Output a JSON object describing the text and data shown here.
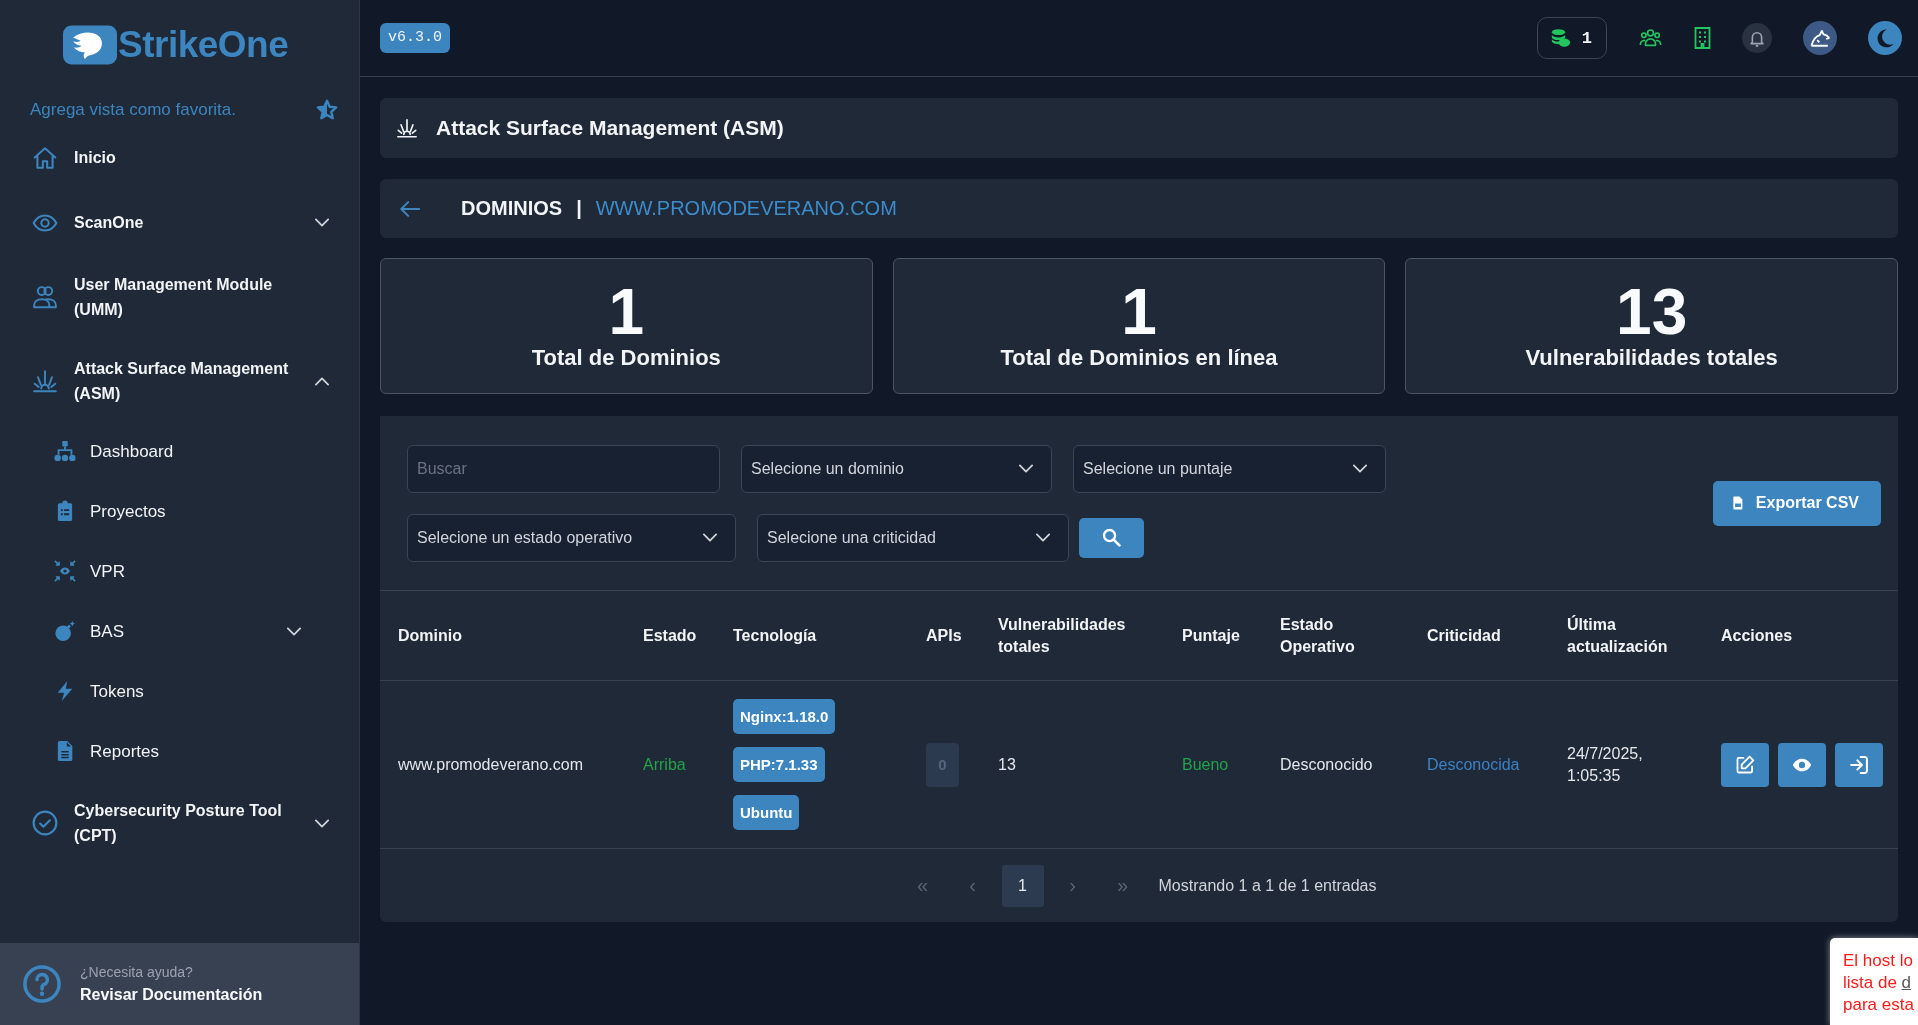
{
  "sidebar": {
    "logo": "StrikeOne",
    "favorite_hint": "Agrega vista como favorita.",
    "nav": [
      {
        "kind": "link",
        "label": "Inicio"
      },
      {
        "kind": "group",
        "label": "ScanOne",
        "expanded": false
      },
      {
        "kind": "link",
        "label": "User Management Module (UMM)"
      },
      {
        "kind": "group",
        "label": "Attack Surface Management (ASM)",
        "expanded": true,
        "children": [
          {
            "kind": "link",
            "label": "Dashboard"
          },
          {
            "kind": "link",
            "label": "Proyectos"
          },
          {
            "kind": "link",
            "label": "VPR"
          },
          {
            "kind": "group",
            "label": "BAS",
            "expanded": false
          },
          {
            "kind": "link",
            "label": "Tokens"
          },
          {
            "kind": "link",
            "label": "Reportes"
          }
        ]
      },
      {
        "kind": "group",
        "label": "Cybersecurity Posture Tool (CPT)",
        "expanded": false
      }
    ],
    "help": {
      "caption": "¿Necesita ayuda?",
      "link": "Revisar Documentación"
    }
  },
  "topbar": {
    "version": "v6.3.0",
    "credits": "1"
  },
  "page_header": {
    "title": "Attack Surface Management (ASM)"
  },
  "breadcrumb": {
    "section": "DOMINIOS",
    "separator": "|",
    "current": "WWW.PROMODEVERANO.COM"
  },
  "stats": [
    {
      "value": "1",
      "label": "Total de Dominios"
    },
    {
      "value": "1",
      "label": "Total de Dominios en línea"
    },
    {
      "value": "13",
      "label": "Vulnerabilidades totales"
    }
  ],
  "filters": {
    "search": {
      "placeholder": "Buscar"
    },
    "selects": [
      {
        "placeholder": "Selecione un dominio"
      },
      {
        "placeholder": "Selecione un puntaje"
      },
      {
        "placeholder": "Selecione un estado operativo"
      },
      {
        "placeholder": "Selecione una criticidad"
      }
    ],
    "export_button": "Exportar CSV"
  },
  "table": {
    "columns": [
      "Dominio",
      "Estado",
      "Tecnología",
      "APIs",
      "Vulnerabilidades totales",
      "Puntaje",
      "Estado Operativo",
      "Criticidad",
      "Última actualización",
      "Acciones"
    ],
    "rows": [
      {
        "domain": "www.promodeverano.com",
        "status": {
          "text": "Arriba",
          "color": "#22a34a"
        },
        "technologies": [
          "Nginx:1.18.0",
          "PHP:7.1.33",
          "Ubuntu"
        ],
        "apis": "0",
        "vulnerabilities": "13",
        "score": {
          "text": "Bueno",
          "color": "#22a34a"
        },
        "operational_state": "Desconocido",
        "criticality": {
          "text": "Desconocida",
          "color": "#3b82c4"
        },
        "updated": "24/7/2025, 1:05:35"
      }
    ]
  },
  "pagination": {
    "first": {
      "label": "«",
      "disabled": true
    },
    "previous": {
      "label": "‹",
      "disabled": true
    },
    "pages": [
      {
        "label": "1",
        "selected": true
      }
    ],
    "next": {
      "label": "›",
      "disabled": true
    },
    "last": {
      "label": "»",
      "disabled": true
    },
    "summary": "Mostrando 1 a 1 de 1 entradas"
  },
  "toast": {
    "lines": [
      {
        "text": "El host lo"
      },
      {
        "text": "lista de ",
        "link": "d"
      },
      {
        "text": "para esta"
      }
    ]
  }
}
